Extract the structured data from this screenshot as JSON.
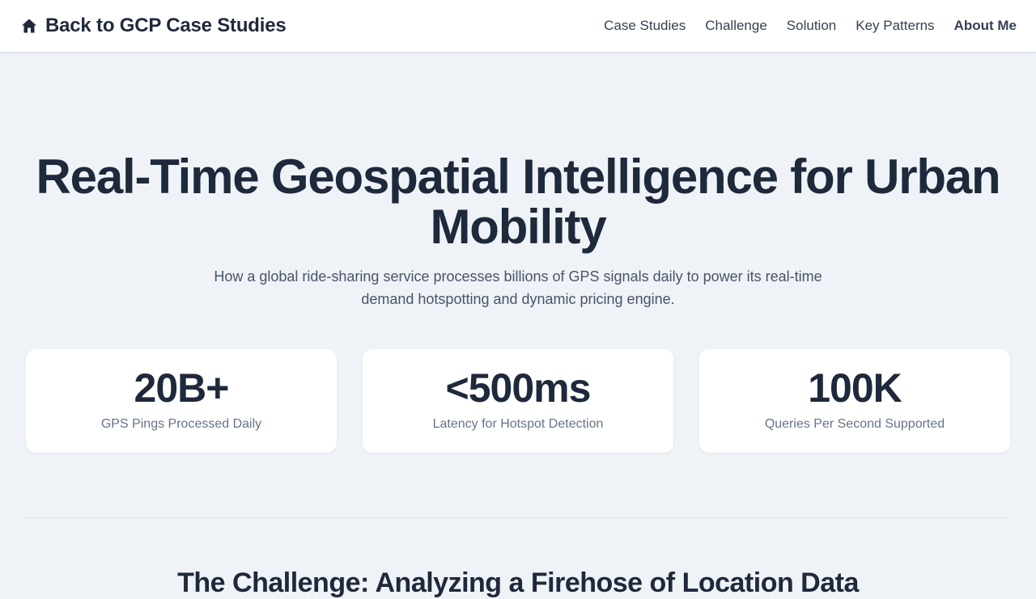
{
  "header": {
    "back_label": "Back to GCP Case Studies",
    "back_icon": "home-icon",
    "nav": [
      {
        "label": "Case Studies"
      },
      {
        "label": "Challenge"
      },
      {
        "label": "Solution"
      },
      {
        "label": "Key Patterns"
      },
      {
        "label": "About Me"
      }
    ]
  },
  "hero": {
    "title": "Real-Time Geospatial Intelligence for Urban Mobility",
    "subtitle": "How a global ride-sharing service processes billions of GPS signals daily to power its real-time demand hotspotting and dynamic pricing engine."
  },
  "stats": [
    {
      "value": "20B+",
      "label": "GPS Pings Processed Daily"
    },
    {
      "value": "<500ms",
      "label": "Latency for Hotspot Detection"
    },
    {
      "value": "100K",
      "label": "Queries Per Second Supported"
    }
  ],
  "challenge": {
    "heading": "The Challenge: Analyzing a Firehose of Location Data"
  },
  "colors": {
    "background": "#eff2f7",
    "text_primary": "#1e293b",
    "text_secondary": "#475569",
    "card": "#ffffff"
  }
}
